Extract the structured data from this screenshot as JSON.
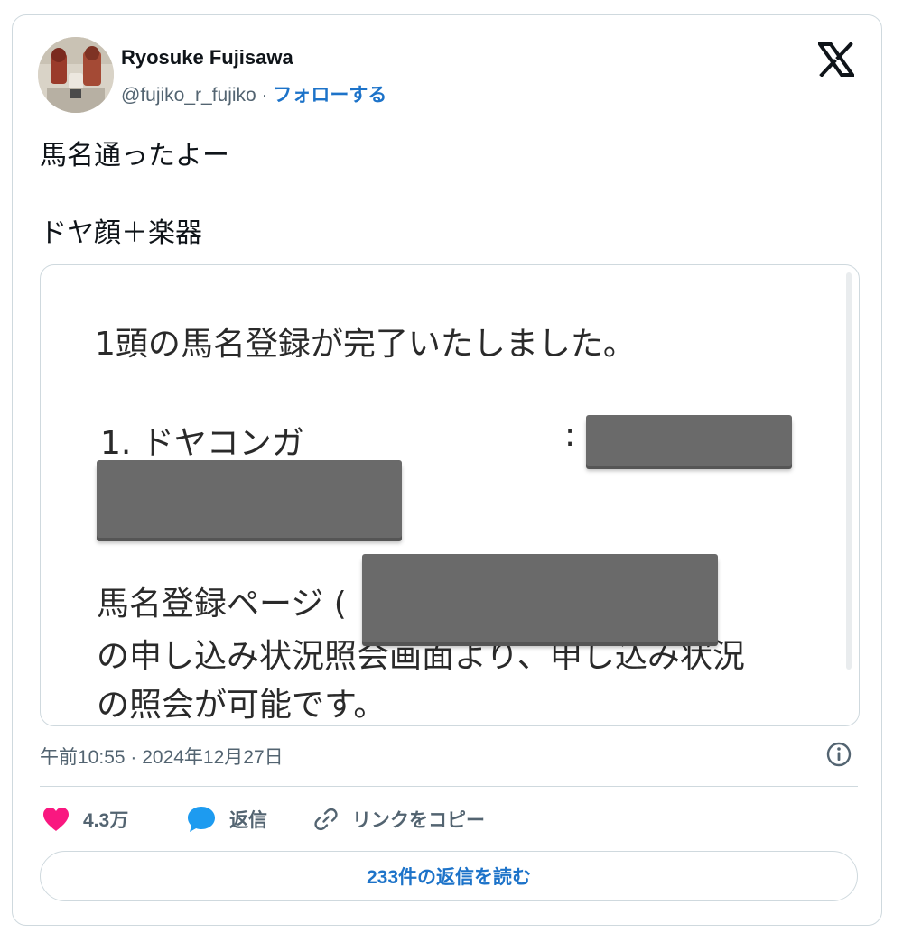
{
  "author": {
    "name": "Ryosuke Fujisawa",
    "handle": "@fujiko_r_fujiko",
    "separator": " · ",
    "follow_label": "フォローする"
  },
  "tweet": {
    "line1": "馬名通ったよー",
    "line2": "ドヤ顔＋楽器"
  },
  "media": {
    "line1": "1頭の馬名登録が完了いたしました。",
    "item_label": "1. ドヤコンガ",
    "colon": ":",
    "line3": "馬名登録ページ (",
    "line4": "の申し込み状況照会画面より、申し込み状況",
    "line5": "の照会が可能です。"
  },
  "timestamp": "午前10:55 · 2024年12月27日",
  "actions": {
    "likes": "4.3万",
    "reply": "返信",
    "copy_link": "リンクをコピー"
  },
  "read_replies": "233件の返信を読む",
  "colors": {
    "like": "#f91880",
    "reply": "#1d9bf0",
    "link": "#1d73c9",
    "redaction": "#6a6a6a"
  },
  "icons": [
    "x-logo-icon",
    "heart-icon",
    "speech-bubble-icon",
    "link-icon",
    "info-icon"
  ]
}
